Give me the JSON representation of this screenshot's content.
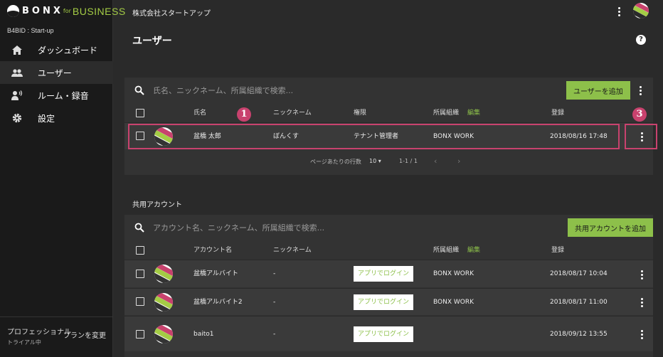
{
  "brand": {
    "mark": "BONX",
    "for": "for",
    "business": "BUSINESS",
    "org_id": "B4BID : Start-up"
  },
  "sidebar": {
    "items": [
      {
        "label": "ダッシュボード",
        "icon": "home-icon"
      },
      {
        "label": "ユーザー",
        "icon": "people-icon"
      },
      {
        "label": "ルーム・録音",
        "icon": "speaker-icon"
      },
      {
        "label": "設定",
        "icon": "gear-icon"
      }
    ],
    "plan": "プロフェッショナル",
    "plan_sub": "トライアル中",
    "plan_button": "プランを変更"
  },
  "header": {
    "company": "株式会社スタートアップ",
    "title": "ユーザー",
    "help": "?"
  },
  "users": {
    "search_placeholder": "氏名、ニックネーム、所属組織で検索...",
    "add_button": "ユーザーを追加",
    "columns": {
      "name": "氏名",
      "nickname": "ニックネーム",
      "role": "権限",
      "org": "所属組織",
      "edit": "編集",
      "registered": "登録"
    },
    "rows": [
      {
        "name": "盆橋 太郎",
        "nickname": "ぼんくす",
        "role": "テナント管理者",
        "org": "BONX WORK",
        "registered": "2018/08/16 17:48"
      }
    ],
    "pager": {
      "rows_per_page_label": "ページあたりの行数",
      "rows_per_page": "10",
      "range": "1-1 / 1"
    }
  },
  "shared": {
    "section_title": "共用アカウント",
    "search_placeholder": "アカウント名、ニックネーム、所属組織で検索...",
    "add_button": "共用アカウントを追加",
    "columns": {
      "name": "アカウント名",
      "nickname": "ニックネーム",
      "org": "所属組織",
      "edit": "編集",
      "registered": "登録"
    },
    "login_label": "アプリでログイン",
    "rows": [
      {
        "name": "盆橋アルバイト",
        "nickname": "-",
        "org": "BONX WORK",
        "registered": "2018/08/17 10:04"
      },
      {
        "name": "盆橋アルバイト2",
        "nickname": "-",
        "org": "BONX WORK",
        "registered": "2018/08/17 11:00"
      },
      {
        "name": "baito1",
        "nickname": "-",
        "org": "",
        "registered": "2018/09/12 13:55"
      }
    ]
  },
  "annotations": {
    "badge1": "1",
    "badge3": "3"
  },
  "colors": {
    "accent": "#8dc04a",
    "highlight": "#c8426e",
    "avatar_pink": "#c8426e",
    "avatar_green": "#a4cc45"
  }
}
